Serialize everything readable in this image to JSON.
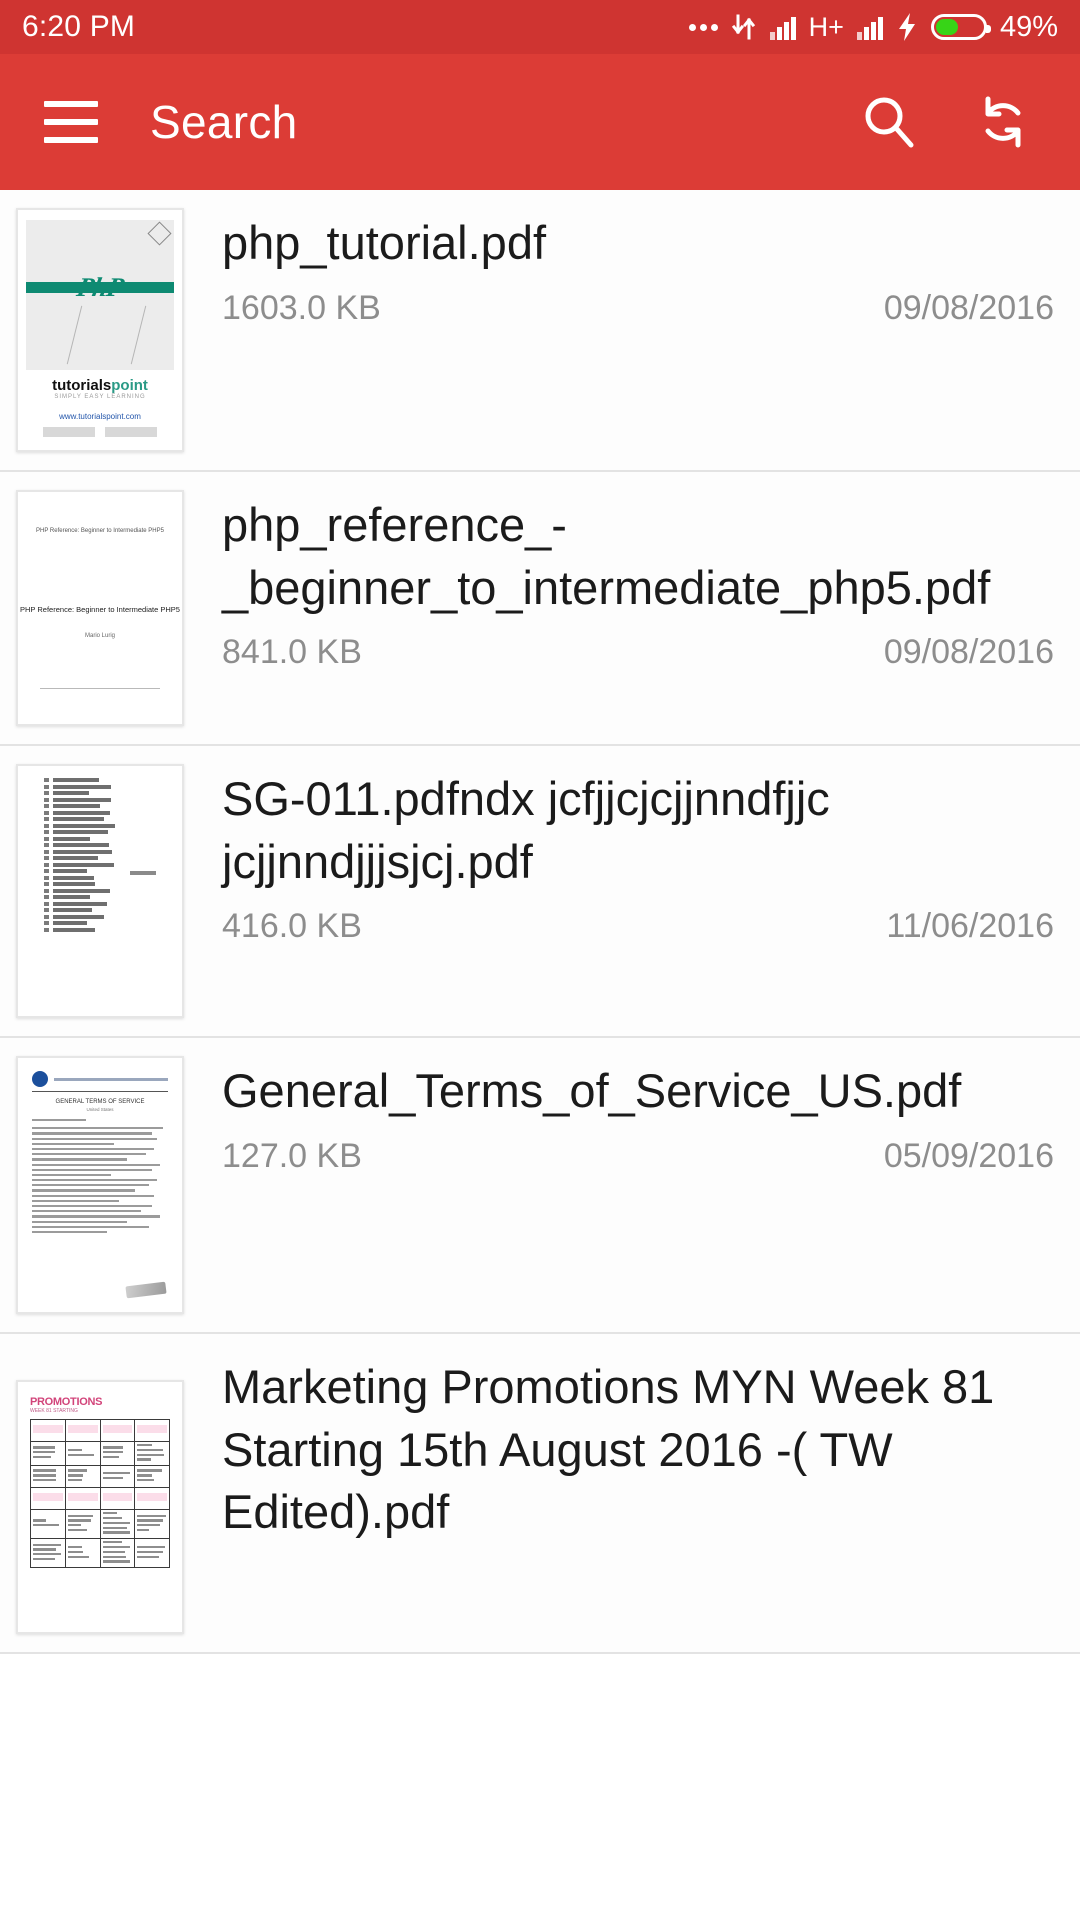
{
  "statusbar": {
    "time": "6:20 PM",
    "network_type": "H+",
    "battery_percent": "49%",
    "battery_level": 49,
    "icons": [
      "more-dots-icon",
      "data-transfer-icon",
      "signal-bars-icon",
      "signal-bars-icon",
      "charging-bolt-icon",
      "battery-icon"
    ]
  },
  "appbar": {
    "title": "Search",
    "menu_icon": "hamburger-menu-icon",
    "search_icon": "search-icon",
    "refresh_icon": "refresh-sync-icon",
    "background_color": "#dc3c36"
  },
  "colors": {
    "accent_red": "#dc3c36",
    "statusbar_red": "#cf3431",
    "battery_green": "#37d417",
    "filename_text": "#1b1b1b",
    "meta_text": "#8d8d8d",
    "divider": "#e3e3e3"
  },
  "files": [
    {
      "name": "php_tutorial.pdf",
      "size": "1603.0 KB",
      "date": "09/08/2016",
      "thumbnail": "php-tutorial-cover-thumbnail",
      "thumb_text": {
        "logo": "PhP",
        "brand_dark": "tutorials",
        "brand_accent": "point",
        "tagline": "SIMPLY EASY LEARNING",
        "url": "www.tutorialspoint.com"
      }
    },
    {
      "name": "php_reference_-_beginner_to_intermediate_php5.pdf",
      "size": "841.0 KB",
      "date": "09/08/2016",
      "thumbnail": "php-reference-cover-thumbnail",
      "thumb_text": {
        "top": "PHP Reference: Beginner to Intermediate PHP5",
        "title": "PHP Reference: Beginner to Intermediate PHP5",
        "author": "Mario Lurig"
      }
    },
    {
      "name": "SG-011.pdfndx jcfjjcjcjjnndfjjc jcjjnndjjjsjcj.pdf",
      "size": "416.0 KB",
      "date": "11/06/2016",
      "thumbnail": "document-list-thumbnail"
    },
    {
      "name": "General_Terms_of_Service_US.pdf",
      "size": "127.0 KB",
      "date": "05/09/2016",
      "thumbnail": "terms-of-service-thumbnail"
    },
    {
      "name": "Marketing Promotions MYN Week 81 Starting 15th August 2016 -( TW Edited).pdf",
      "size": "",
      "date": "",
      "thumbnail": "marketing-table-thumbnail",
      "thumb_text": {
        "title": "PROMOTIONS",
        "subtitle": "WEEK 81 STARTING"
      }
    }
  ]
}
